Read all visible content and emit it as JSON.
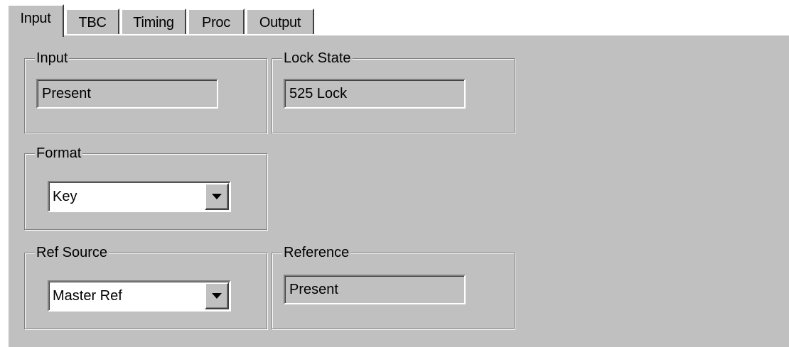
{
  "tabs": [
    {
      "label": "Input",
      "active": true
    },
    {
      "label": "TBC",
      "active": false
    },
    {
      "label": "Timing",
      "active": false
    },
    {
      "label": "Proc",
      "active": false
    },
    {
      "label": "Output",
      "active": false
    }
  ],
  "groups": {
    "input": {
      "title": "Input",
      "value": "Present"
    },
    "lock_state": {
      "title": "Lock State",
      "value": "525 Lock"
    },
    "format": {
      "title": "Format",
      "selected": "Key"
    },
    "ref_source": {
      "title": "Ref Source",
      "selected": "Master Ref"
    },
    "reference": {
      "title": "Reference",
      "value": "Present"
    }
  },
  "icons": {
    "dropdown": "chevron-down-icon"
  },
  "colors": {
    "panel": "#c0c0c0",
    "highlight": "#ffffff",
    "shadow": "#808080"
  }
}
